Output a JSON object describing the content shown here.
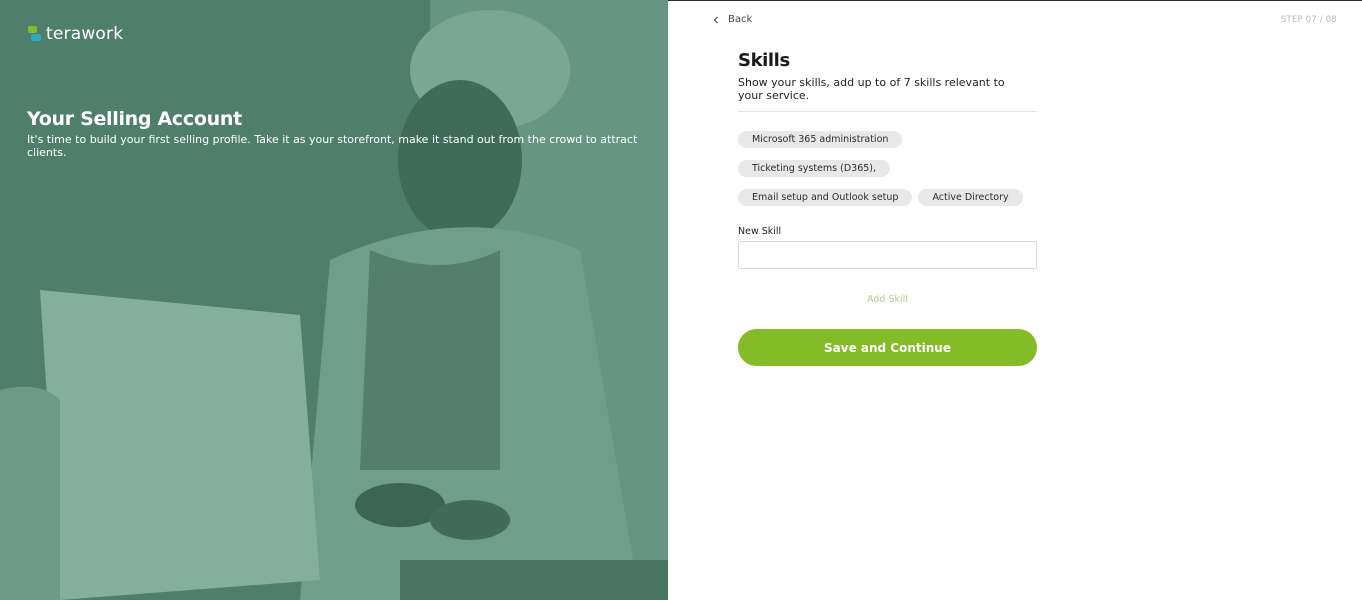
{
  "brand": {
    "name": "terawork"
  },
  "hero": {
    "title": "Your Selling Account",
    "subtitle": "It's time to build your first selling profile. Take it as your storefront, make it stand out from the crowd to attract clients."
  },
  "nav": {
    "back_label": "Back",
    "step": "STEP 07 / 08"
  },
  "skills": {
    "title": "Skills",
    "description": "Show your skills, add up to of 7 skills relevant to your service.",
    "chips": [
      "Microsoft 365 administration",
      "Ticketing systems (D365),",
      "Email setup and Outlook setup",
      "Active Directory"
    ],
    "new_skill_label": "New Skill",
    "new_skill_value": "",
    "add_skill_label": "Add Skill",
    "save_label": "Save and Continue"
  },
  "colors": {
    "hero_bg": "#5a8a76",
    "primary_green": "#84bc27",
    "add_skill_green": "#a7d28a",
    "chip_bg": "#e8e8e8"
  }
}
